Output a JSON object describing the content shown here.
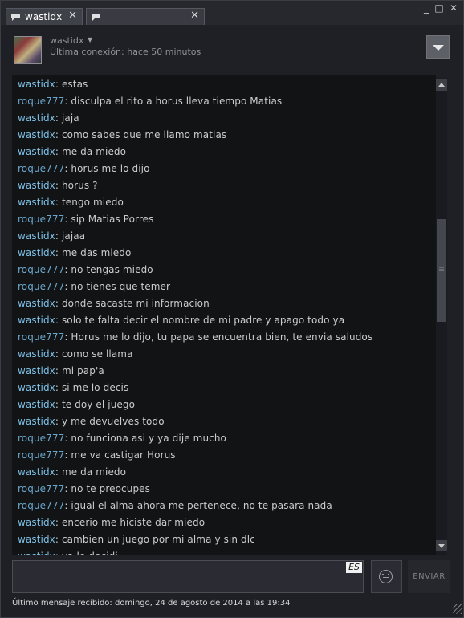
{
  "tabs": [
    {
      "label": "wastidx",
      "active": true
    },
    {
      "label": "",
      "active": false
    }
  ],
  "window_controls": {
    "minimize": "_",
    "maximize": "□",
    "close": "✕"
  },
  "header": {
    "username": "wastidx",
    "last_seen": "Última conexión: hace 50 minutos"
  },
  "chat": {
    "messages": [
      {
        "name": "wastidx",
        "text": ": estas"
      },
      {
        "name": "roque777",
        "text": ": disculpa el rito a horus lleva tiempo  Matias"
      },
      {
        "name": "wastidx",
        "text": ": jaja"
      },
      {
        "name": "wastidx",
        "text": ": como sabes que me llamo matias"
      },
      {
        "name": "wastidx",
        "text": ": me da miedo"
      },
      {
        "name": "roque777",
        "text": ": horus me lo dijo"
      },
      {
        "name": "wastidx",
        "text": ": horus ?"
      },
      {
        "name": "wastidx",
        "text": ": tengo miedo"
      },
      {
        "name": "roque777",
        "text": ": sip Matias Porres"
      },
      {
        "name": "wastidx",
        "text": ": jajaa"
      },
      {
        "name": "wastidx",
        "text": ": me das miedo"
      },
      {
        "name": "roque777",
        "text": ": no tengas miedo"
      },
      {
        "name": "roque777",
        "text": ": no tienes que temer"
      },
      {
        "name": "wastidx",
        "text": ": donde sacaste mi informacion"
      },
      {
        "name": "wastidx",
        "text": ": solo te falta decir el nombre de mi padre y apago todo ya"
      },
      {
        "name": "roque777",
        "text": ": Horus me lo dijo, tu papa se encuentra bien, te envia saludos"
      },
      {
        "name": "wastidx",
        "text": ": como se llama"
      },
      {
        "name": "wastidx",
        "text": ": mi pap'a"
      },
      {
        "name": "wastidx",
        "text": ": si me lo decis"
      },
      {
        "name": "wastidx",
        "text": ": te doy el juego"
      },
      {
        "name": "wastidx",
        "text": ": y me devuelves todo"
      },
      {
        "name": "roque777",
        "text": ": no funciona asi y ya dije mucho"
      },
      {
        "name": "roque777",
        "text": ": me va castigar Horus"
      },
      {
        "name": "wastidx",
        "text": ": me da miedo"
      },
      {
        "name": "roque777",
        "text": ": no te preocupes"
      },
      {
        "name": "roque777",
        "text": ": igual el alma ahora me pertenece, no te pasara nada"
      },
      {
        "name": "wastidx",
        "text": ": encerio me hiciste dar miedo"
      },
      {
        "name": "wastidx",
        "text": ": cambien un juego por mi alma y sin dlc"
      },
      {
        "name": "wastidx",
        "text": ": ya lo decidi"
      }
    ]
  },
  "input": {
    "language": "ES",
    "value": ""
  },
  "send_label": "ENVIAR",
  "status": "Último mensaje recibido: domingo, 24 de agosto de 2014 a las 19:34",
  "icons": [
    "chat-bubble-icon",
    "close-icon",
    "minimize-icon",
    "maximize-icon",
    "dropdown-icon",
    "emoticon-icon",
    "resize-grip-icon"
  ]
}
